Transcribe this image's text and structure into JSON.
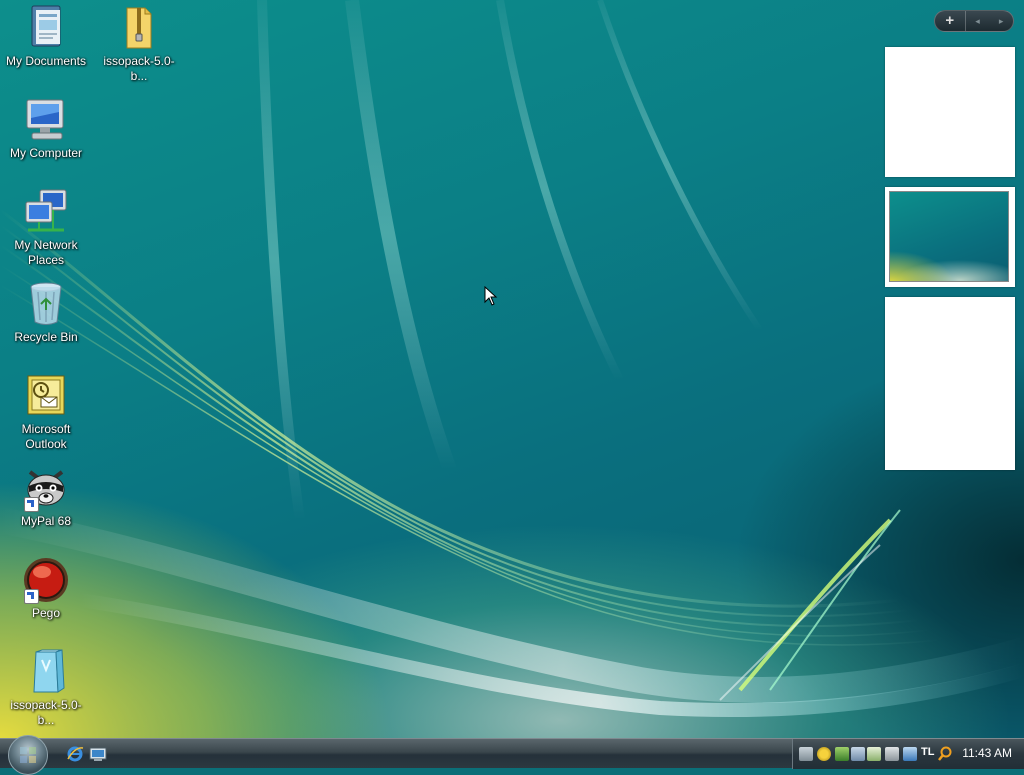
{
  "desktop": {
    "icons": [
      {
        "label": "My Documents",
        "icon": "documents-folder-icon"
      },
      {
        "label": "issopack-5.0-b...",
        "icon": "zip-folder-icon"
      },
      {
        "label": "My Computer",
        "icon": "computer-icon"
      },
      {
        "label": "My Network Places",
        "icon": "network-icon"
      },
      {
        "label": "Recycle Bin",
        "icon": "recycle-bin-icon"
      },
      {
        "label": "Microsoft Outlook",
        "icon": "outlook-icon"
      },
      {
        "label": "MyPal 68",
        "icon": "raccoon-browser-icon"
      },
      {
        "label": "Pego",
        "icon": "red-orb-icon"
      },
      {
        "label": "issopack-5.0-b...",
        "icon": "installer-box-icon"
      }
    ]
  },
  "sidebar": {
    "add_label": "+",
    "prev_label": "◂",
    "next_label": "▸"
  },
  "taskbar": {
    "quick_launch": [
      "internet-explorer-icon",
      "show-desktop-icon"
    ],
    "tray_icons": [
      "network-status-icon",
      "security-shield-icon",
      "display-icon",
      "drive-icon",
      "checkmark-icon",
      "power-plug-icon",
      "monitor-icon",
      "input-language-icon",
      "search-magnifier-icon"
    ],
    "language": "TL",
    "clock": "11:43 AM"
  },
  "colors": {
    "taskbar": "#2c3840",
    "wallpaper_teal": "#0b7f86",
    "wallpaper_yellow": "#e8dc3c"
  }
}
